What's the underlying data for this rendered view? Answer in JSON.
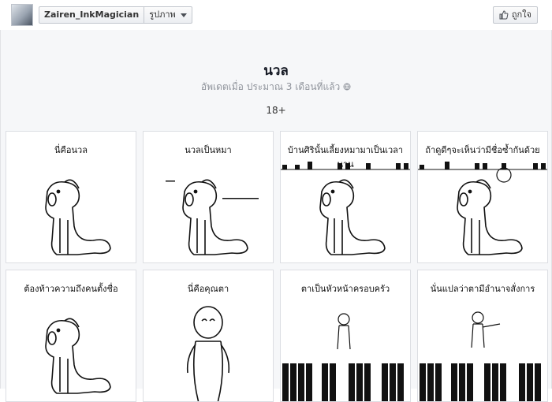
{
  "header": {
    "user_name": "Zairen_InkMagician",
    "section_label": "รูปภาพ",
    "like_label": "ถูกใจ"
  },
  "album": {
    "title": "นวล",
    "updated": "อัพเดตเมื่อ ประมาณ 3 เดือนที่แล้ว",
    "age_rating": "18+"
  },
  "panels": [
    {
      "caption": "นี่คือนวล"
    },
    {
      "caption": "นวลเป็นหมา"
    },
    {
      "caption": "บ้านศิรินั้นเลี้ยงหมามาเป็นเวลานาน"
    },
    {
      "caption": "ถ้าดูดีๆจะเห็นว่ามีชื่อซ้ำกันด้วย"
    },
    {
      "caption": "ต้องท้าวความถึงคนตั้งชื่อ"
    },
    {
      "caption": "นี่คือคุณตา"
    },
    {
      "caption": "ตาเป็นหัวหน้าครอบครัว"
    },
    {
      "caption": "นั่นแปลว่าตามีอำนาจสั่งการ"
    }
  ],
  "icons": {
    "avatar": "user-avatar",
    "dropdown": "chevron-down-icon",
    "like": "thumbs-up-icon",
    "globe": "globe-icon"
  }
}
